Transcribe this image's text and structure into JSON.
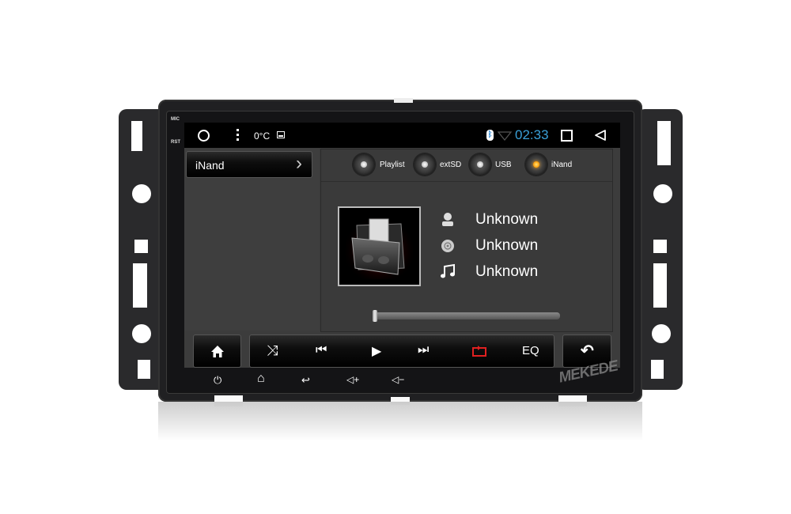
{
  "device": {
    "brand_watermark": "MEKEDE",
    "bezel_labels": {
      "mic": "MIC",
      "rst": "RST"
    }
  },
  "statusbar": {
    "left_icons": [
      "circle-icon",
      "overflow-menu-icon"
    ],
    "temperature": "0°C",
    "notification_icon": "image-icon",
    "bluetooth_icon": "bluetooth-icon",
    "wifi_icon": "wifi-icon",
    "time": "02:33",
    "nav_icons": [
      "recents-icon",
      "back-icon"
    ],
    "time_color": "#3aa0d8"
  },
  "sidebar": {
    "current_folder": "iNand",
    "chevron": "›"
  },
  "sources": [
    {
      "label": "Playlist",
      "active": false
    },
    {
      "label": "extSD",
      "active": false
    },
    {
      "label": "USB",
      "active": false
    },
    {
      "label": "iNand",
      "active": true
    }
  ],
  "track": {
    "artist": "Unknown",
    "album": "Unknown",
    "title": "Unknown",
    "progress": 0
  },
  "controls": {
    "home": "home-icon",
    "shuffle": "⤨",
    "prev": "⏮",
    "play": "▶",
    "next": "⏭",
    "repeat": "repeat-icon",
    "eq_label": "EQ",
    "back": "↶",
    "accent_repeat": "#e02020"
  },
  "hardware_keys": {
    "power": "⏻",
    "home": "⌂",
    "back": "↩",
    "vol_up": "◁+",
    "vol_down": "◁−"
  }
}
